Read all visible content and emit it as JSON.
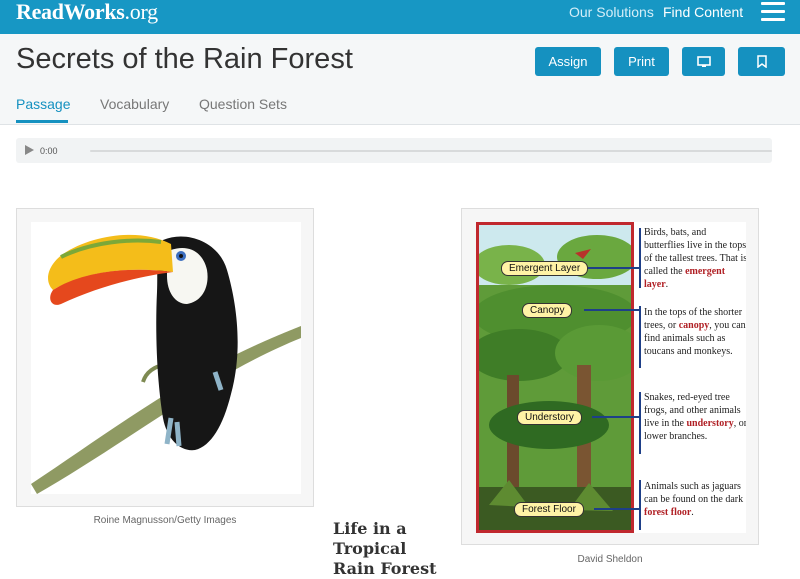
{
  "topbar": {
    "logo_main": "ReadWorks",
    "logo_suffix": ".org",
    "nav": [
      "Our Solutions",
      "Find Content"
    ]
  },
  "header": {
    "title": "Secrets of the Rain Forest",
    "buttons": {
      "assign": "Assign",
      "print": "Print"
    },
    "tabs": [
      "Passage",
      "Vocabulary",
      "Question Sets"
    ],
    "active_tab": "Passage"
  },
  "audio": {
    "time": "0:00"
  },
  "figures": [
    {
      "caption": "Roine Magnusson/Getty Images"
    },
    {
      "caption": "David Sheldon",
      "layers": [
        "Emergent Layer",
        "Canopy",
        "Understory",
        "Forest Floor"
      ],
      "annotations": [
        {
          "before": "Birds, bats, and butterflies live in the tops of the tallest trees. That is called the ",
          "keyword": "emergent layer",
          "after": "."
        },
        {
          "before": "In the tops of the shorter trees, or ",
          "keyword": "canopy",
          "after": ", you can find animals such as toucans and monkeys."
        },
        {
          "before": "Snakes, red-eyed tree frogs, and other animals live in the ",
          "keyword": "understory",
          "after": ", or lower branches."
        },
        {
          "before": "Animals such as jaguars can be found on the dark ",
          "keyword": "forest floor",
          "after": "."
        }
      ]
    }
  ],
  "article": {
    "title": "Life in a Tropical Rain Forest"
  },
  "colors": {
    "brand": "#1797c4",
    "button": "#1591c0",
    "keyword": "#b01f24"
  }
}
